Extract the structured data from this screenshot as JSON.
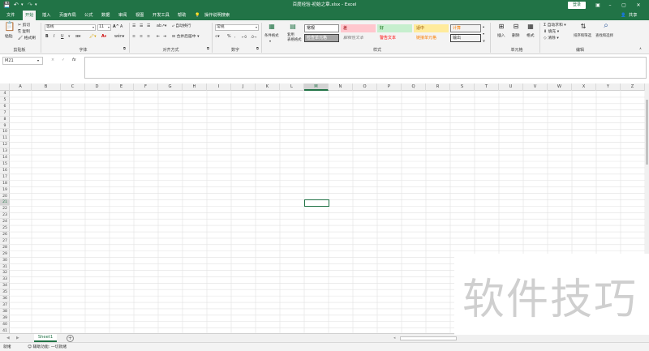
{
  "titlebar": {
    "title": "百度经验-初始之章.xlsx  -  Excel",
    "login": "登录",
    "qa_icons": [
      "save-icon",
      "undo-icon",
      "redo-icon",
      "customize-icon"
    ]
  },
  "tabs": [
    "文件",
    "开始",
    "插入",
    "页面布局",
    "公式",
    "数据",
    "审阅",
    "视图",
    "开发工具",
    "帮助",
    "操作说明搜索"
  ],
  "share": "共享",
  "ribbon": {
    "clipboard": {
      "paste": "粘贴",
      "cut": "剪切",
      "copy": "复制",
      "format_painter": "格式刷",
      "label": "剪贴板"
    },
    "font": {
      "name": "等线",
      "size": "11",
      "bold": "B",
      "italic": "I",
      "underline": "U",
      "grow": "A^",
      "shrink": "A",
      "label": "字体"
    },
    "alignment": {
      "wrap": "自动换行",
      "merge": "合并后居中",
      "label": "对齐方式"
    },
    "number": {
      "format": "常规",
      "percent": "%",
      "comma": ",",
      "label": "数字"
    },
    "styles": {
      "conditional": "条件格式",
      "table": "套用\n表格格式",
      "cells": [
        {
          "text": "常规",
          "bg": "#ffffff",
          "fg": "#000000",
          "border": "#8e8e8e"
        },
        {
          "text": "差",
          "bg": "#ffc7ce",
          "fg": "#9c0006"
        },
        {
          "text": "好",
          "bg": "#c6efce",
          "fg": "#006100"
        },
        {
          "text": "适中",
          "bg": "#ffeb9c",
          "fg": "#9c5700"
        },
        {
          "text": "计算",
          "bg": "#f2f2f2",
          "fg": "#fa7d00",
          "border": "#7f7f7f"
        },
        {
          "text": "检查单元格",
          "bg": "#a5a5a5",
          "fg": "#ffffff",
          "border": "#3f3f3f"
        },
        {
          "text": "解释性文本",
          "bg": "#f3f3f3",
          "fg": "#7f7f7f"
        },
        {
          "text": "警告文本",
          "bg": "#f3f3f3",
          "fg": "#ff0000"
        },
        {
          "text": "链接单元格",
          "bg": "#f3f3f3",
          "fg": "#fa7d00"
        },
        {
          "text": "输出",
          "bg": "#f2f2f2",
          "fg": "#3f3f3f",
          "border": "#3f3f3f"
        }
      ],
      "label": "样式"
    },
    "cells_group": {
      "insert": "插入",
      "delete": "删除",
      "format": "格式",
      "label": "单元格"
    },
    "editing": {
      "autosum": "自动求和",
      "fill": "填充",
      "clear": "清除",
      "sort": "排序和筛选",
      "find": "查找和选择",
      "label": "编辑"
    }
  },
  "formula": {
    "namebox": "M21",
    "cancel": "×",
    "enter": "✓",
    "fx": "fx",
    "value": ""
  },
  "columns": [
    "A",
    "B",
    "C",
    "D",
    "E",
    "F",
    "G",
    "H",
    "I",
    "J",
    "K",
    "L",
    "M",
    "N",
    "O",
    "P",
    "Q",
    "R",
    "S",
    "T",
    "U",
    "V",
    "W",
    "X",
    "Y",
    "Z"
  ],
  "selected_column": "M",
  "rows_start": 4,
  "rows_end": 41,
  "selected_row": 21,
  "sheet": {
    "tab": "Sheet1",
    "add": "+"
  },
  "status": {
    "ready": "就绪",
    "accessibility": "辅助功能: 一切就绪"
  },
  "watermark": "软件技巧",
  "colors": {
    "accent": "#217346",
    "ribbon_bg": "#f3f3f3",
    "grid_line": "#e1e1e1"
  }
}
